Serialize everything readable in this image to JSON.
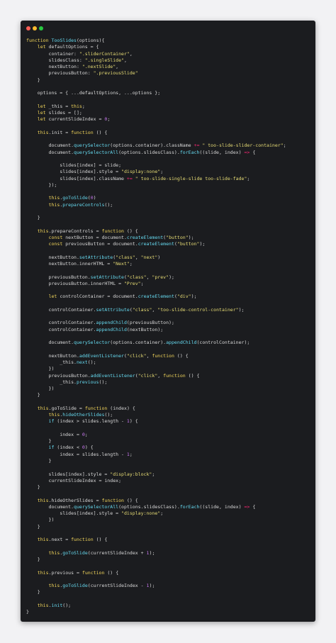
{
  "window": {
    "controls": [
      "close",
      "minimize",
      "maximize"
    ]
  },
  "editor": {
    "language": "javascript",
    "lines": [
      "function TooSlides(options){",
      "    let defaultOptions = {",
      "        container: \".sliderContainer\",",
      "        slidesClass: \".singleSlide\",",
      "        nextButton: \".nextSlide\",",
      "        previousButton: \".previousSlide\"",
      "    }",
      "",
      "    options = { ...defaultOptions, ...options };",
      "",
      "    let _this = this;",
      "    let slides = [];",
      "    let currentSlideIndex = 0;",
      "",
      "    this.init = function () {",
      "",
      "        document.querySelector(options.container).className += \" too-slide-slider-container\";",
      "        document.querySelectorAll(options.slidesClass).forEach((slide, index) => {",
      "",
      "            slides[index] = slide;",
      "            slides[index].style = \"display:none\";",
      "            slides[index].className += \" too-slide-single-slide too-slide-fade\";",
      "        });",
      "",
      "        this.goToSlide(0)",
      "        this.prepareControls();",
      "",
      "    }",
      "",
      "    this.prepareControls = function () {",
      "        const nextButton = document.createElement(\"button\");",
      "        const previousButton = document.createElement(\"button\");",
      "",
      "        nextButton.setAttribute(\"class\", \"next\")",
      "        nextButton.innerHTML = \"Next\";",
      "",
      "        previousButton.setAttribute(\"class\", \"prev\");",
      "        previousButton.innerHTML = \"Prev\";",
      "",
      "        let controlContainer = document.createElement(\"div\");",
      "",
      "        controlContainer.setAttribute(\"class\", \"too-slide-control-container\");",
      "",
      "        controlContainer.appendChild(previousButton);",
      "        controlContainer.appendChild(nextButton);",
      "",
      "        document.querySelector(options.container).appendChild(controlContainer);",
      "",
      "        nextButton.addEventListener(\"click\", function () {",
      "            _this.next();",
      "        })",
      "        previousButton.addEventListener(\"click\", function () {",
      "            _this.previous();",
      "        })",
      "    }",
      "",
      "    this.goToSlide = function (index) {",
      "        this.hideOtherSlides();",
      "        if (index > slides.length - 1) {",
      "",
      "            index = 0;",
      "        }",
      "        if (index < 0) {",
      "            index = slides.length - 1;",
      "        }",
      "",
      "        slides[index].style = \"display:block\";",
      "        currentSlideIndex = index;",
      "    }",
      "",
      "    this.hideOtherSlides = function () {",
      "        document.querySelectorAll(options.slidesClass).forEach((slide, index) => {",
      "            slides[index].style = \"display:none\";",
      "        })",
      "    }",
      "",
      "    this.next = function () {",
      "",
      "        this.goToSlide(currentSlideIndex + 1);",
      "    }",
      "",
      "    this.previous = function () {",
      "",
      "        this.goToSlide(currentSlideIndex - 1);",
      "    }",
      "",
      "    this.init();",
      "}"
    ]
  }
}
